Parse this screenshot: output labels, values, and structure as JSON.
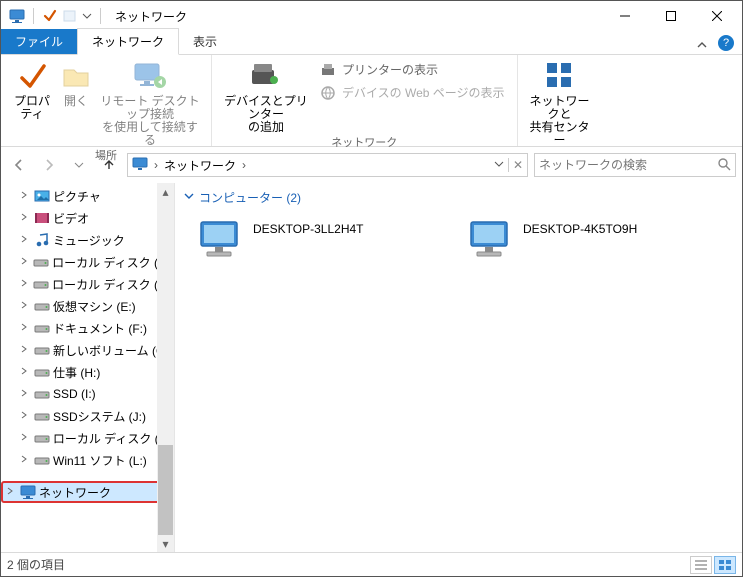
{
  "window": {
    "title": "ネットワーク"
  },
  "tabs": {
    "file": "ファイル",
    "network": "ネットワーク",
    "view": "表示"
  },
  "ribbon": {
    "properties": "プロパティ",
    "open": "開く",
    "rdp": "リモート デスクトップ接続\nを使用して接続する",
    "group_location": "場所",
    "devices_printers": "デバイスとプリンター\nの追加",
    "show_printers": "プリンターの表示",
    "show_web": "デバイスの Web ページの表示",
    "group_network": "ネットワーク",
    "net_sharing": "ネットワークと\n共有センター"
  },
  "address": {
    "crumb1": "ネットワーク",
    "search_placeholder": "ネットワークの検索"
  },
  "tree": [
    {
      "label": "ピクチャ",
      "icon": "pic",
      "exp": true
    },
    {
      "label": "ビデオ",
      "icon": "vid",
      "exp": true
    },
    {
      "label": "ミュージック",
      "icon": "music",
      "exp": true
    },
    {
      "label": "ローカル ディスク (C:)",
      "icon": "drive",
      "exp": true
    },
    {
      "label": "ローカル ディスク (D:)",
      "icon": "drive",
      "exp": true
    },
    {
      "label": "仮想マシン (E:)",
      "icon": "drive",
      "exp": true
    },
    {
      "label": "ドキュメント (F:)",
      "icon": "drive",
      "exp": true
    },
    {
      "label": "新しいボリューム (G:)",
      "icon": "drive",
      "exp": true
    },
    {
      "label": "仕事 (H:)",
      "icon": "drive",
      "exp": true
    },
    {
      "label": "SSD (I:)",
      "icon": "drive",
      "exp": true
    },
    {
      "label": "SSDシステム (J:)",
      "icon": "drive",
      "exp": true
    },
    {
      "label": "ローカル ディスク (K:)",
      "icon": "drive",
      "exp": true
    },
    {
      "label": "Win11 ソフト (L:)",
      "icon": "drive",
      "exp": true
    },
    {
      "label": "ネットワーク",
      "icon": "net",
      "exp": true,
      "selected": true,
      "highlight": true,
      "top": true
    }
  ],
  "group": {
    "header": "コンピューター",
    "count": 2
  },
  "computers": [
    {
      "name": "DESKTOP-3LL2H4T"
    },
    {
      "name": "DESKTOP-4K5TO9H"
    }
  ],
  "status": {
    "text": "2 個の項目"
  }
}
